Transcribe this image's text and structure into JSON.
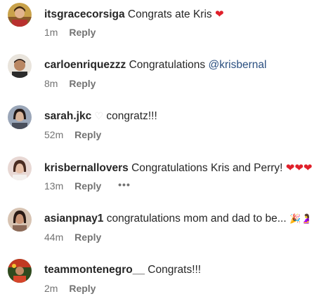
{
  "comments": [
    {
      "username": "itsgracecorsiga",
      "text": "Congrats ate Kris",
      "emoji": "❤",
      "time": "1m",
      "reply": "Reply"
    },
    {
      "username": "carloenriquezzz",
      "text": "Congratulations",
      "mention": "@krisbernal",
      "time": "8m",
      "reply": "Reply"
    },
    {
      "username": "sarah.jkc",
      "emoji": "♡",
      "text": "congratz!!!",
      "time": "52m",
      "reply": "Reply"
    },
    {
      "username": "krisbernallovers",
      "text": "Congratulations Kris and Perry!",
      "emoji": "❤❤❤",
      "time": "13m",
      "reply": "Reply",
      "more": "•••"
    },
    {
      "username": "asianpnay1",
      "text": "congratulations mom and dad to be...",
      "emoji": "🎉🤰",
      "time": "44m",
      "reply": "Reply"
    },
    {
      "username": "teammontenegro__",
      "text": "Congrats!!!",
      "time": "2m",
      "reply": "Reply"
    }
  ],
  "colors": {
    "text": "#262626",
    "muted": "#737373",
    "mention": "#2a4f80",
    "heart": "#e0202a"
  }
}
